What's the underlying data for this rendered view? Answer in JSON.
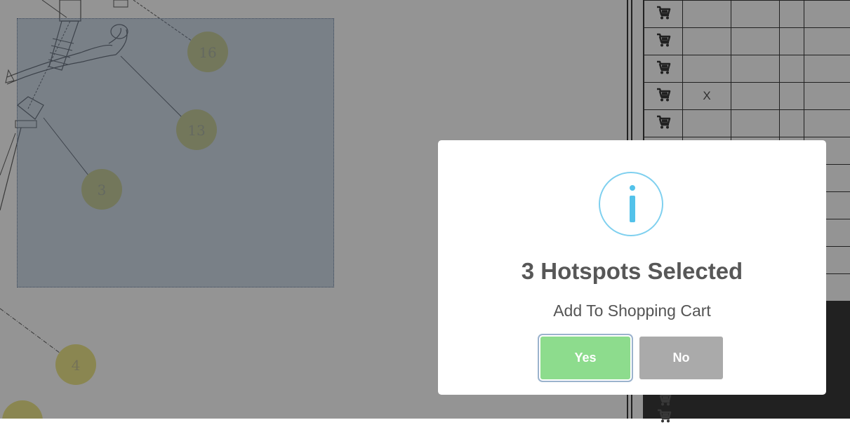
{
  "diagram": {
    "hotspots": [
      "16",
      "13",
      "3",
      "4"
    ]
  },
  "parts_table": {
    "rows": [
      {
        "icon": "cart-icon",
        "c1": "",
        "c2": "",
        "c3": "",
        "c4": ""
      },
      {
        "icon": "cart-icon",
        "c1": "",
        "c2": "",
        "c3": "",
        "c4": ""
      },
      {
        "icon": "cart-icon",
        "c1": "",
        "c2": "",
        "c3": "",
        "c4": ""
      },
      {
        "icon": "cart-icon",
        "c1": "X",
        "c2": "",
        "c3": "",
        "c4": ""
      },
      {
        "icon": "cart-icon",
        "c1": "",
        "c2": "",
        "c3": "",
        "c4": ""
      }
    ]
  },
  "modal": {
    "icon": "info-icon",
    "title": "3 Hotspots Selected",
    "text": "Add To Shopping Cart",
    "yes_label": "Yes",
    "no_label": "No"
  },
  "colors": {
    "hotspot": "#e8e06a",
    "selection": "#557daf",
    "yes_button": "#8ddc8d",
    "no_button": "#aaaaaa",
    "info_icon": "#53c2ea"
  }
}
